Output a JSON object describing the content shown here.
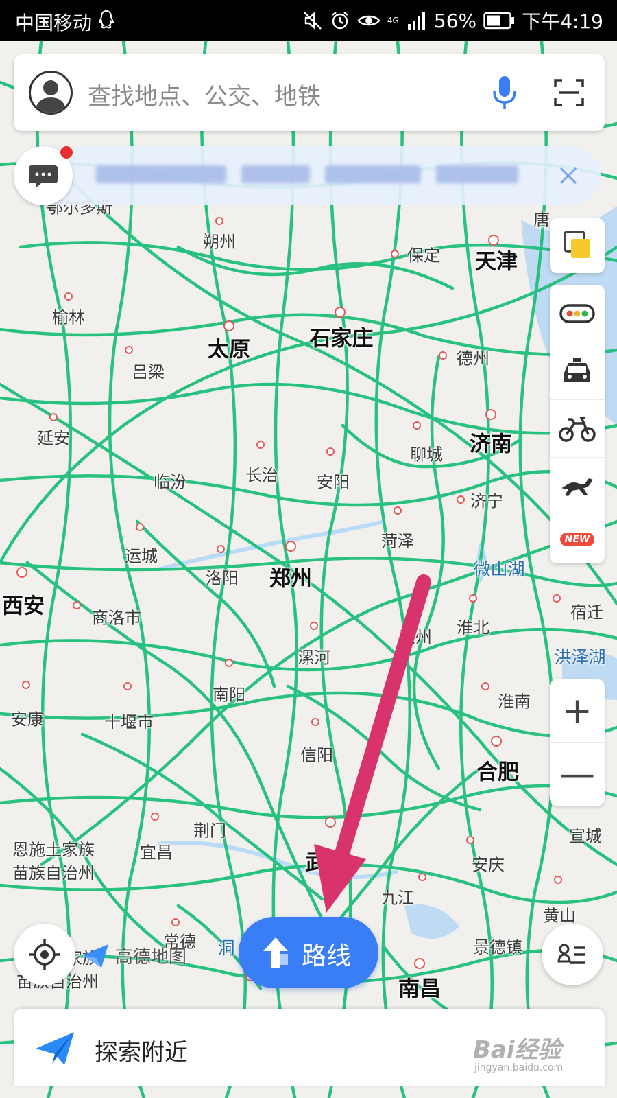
{
  "status_bar": {
    "carrier": "中国移动",
    "network": "4G",
    "battery": "56%",
    "time": "下午4:19"
  },
  "search": {
    "placeholder": "查找地点、公交、地铁",
    "icons": [
      "avatar-icon",
      "microphone-icon",
      "scan-icon"
    ]
  },
  "message_banner": {
    "icon": "message-icon",
    "close_icon": "close-icon"
  },
  "map": {
    "labels": [
      {
        "name": "鄂尔多斯",
        "size": "small"
      },
      {
        "name": "朔州",
        "size": "small"
      },
      {
        "name": "保定",
        "size": "small"
      },
      {
        "name": "天津",
        "size": "big"
      },
      {
        "name": "唐",
        "size": "small"
      },
      {
        "name": "榆林",
        "size": "small"
      },
      {
        "name": "太原",
        "size": "big"
      },
      {
        "name": "石家庄",
        "size": "big"
      },
      {
        "name": "德州",
        "size": "small"
      },
      {
        "name": "吕梁",
        "size": "small"
      },
      {
        "name": "延安",
        "size": "small"
      },
      {
        "name": "济南",
        "size": "big"
      },
      {
        "name": "聊城",
        "size": "small"
      },
      {
        "name": "临汾",
        "size": "small"
      },
      {
        "name": "长治",
        "size": "small"
      },
      {
        "name": "安阳",
        "size": "small"
      },
      {
        "name": "济宁",
        "size": "small"
      },
      {
        "name": "菏泽",
        "size": "small"
      },
      {
        "name": "运城",
        "size": "small"
      },
      {
        "name": "微山湖",
        "size": "water"
      },
      {
        "name": "洛阳",
        "size": "small"
      },
      {
        "name": "郑州",
        "size": "big"
      },
      {
        "name": "西安",
        "size": "big"
      },
      {
        "name": "商洛市",
        "size": "small"
      },
      {
        "name": "宿迁",
        "size": "small"
      },
      {
        "name": "淮北",
        "size": "small"
      },
      {
        "name": "亳州",
        "size": "small"
      },
      {
        "name": "漯河",
        "size": "small"
      },
      {
        "name": "洪泽湖",
        "size": "water"
      },
      {
        "name": "南阳",
        "size": "small"
      },
      {
        "name": "淮南",
        "size": "small"
      },
      {
        "name": "安康",
        "size": "small"
      },
      {
        "name": "十堰市",
        "size": "small"
      },
      {
        "name": "信阳",
        "size": "small"
      },
      {
        "name": "合肥",
        "size": "big"
      },
      {
        "name": "荆门",
        "size": "small"
      },
      {
        "name": "宣城",
        "size": "small"
      },
      {
        "name": "恩施土家族",
        "size": "small"
      },
      {
        "name": "苗族自治州",
        "size": "small"
      },
      {
        "name": "宜昌",
        "size": "small"
      },
      {
        "name": "武汉",
        "size": "big"
      },
      {
        "name": "安庆",
        "size": "small"
      },
      {
        "name": "九江",
        "size": "small"
      },
      {
        "name": "黄山",
        "size": "small"
      },
      {
        "name": "景德镇",
        "size": "small"
      },
      {
        "name": "常德",
        "size": "small"
      },
      {
        "name": "南昌",
        "size": "big"
      },
      {
        "name": "洞",
        "size": "water"
      },
      {
        "name": "湘西土家族",
        "size": "small"
      },
      {
        "name": "苗族自治州",
        "size": "small"
      }
    ]
  },
  "tools": {
    "layers_icon": "layers-icon",
    "items": [
      "traffic-icon",
      "taxi-icon",
      "bike-icon",
      "horse-icon"
    ],
    "new_badge": "NEW",
    "zoom_in": "+",
    "zoom_out": "—"
  },
  "controls": {
    "locate_icon": "locate-icon",
    "list_icon": "list-icon",
    "route_label": "路线",
    "logo_text": "高德地图"
  },
  "bottom_bar": {
    "label": "探索附近",
    "watermark": "Bai经验",
    "watermark_sub": "jingyan.baidu.com"
  },
  "colors": {
    "road": "#1fbf7a",
    "accent": "#3a7ef6",
    "annotation_arrow": "#d8336c"
  }
}
